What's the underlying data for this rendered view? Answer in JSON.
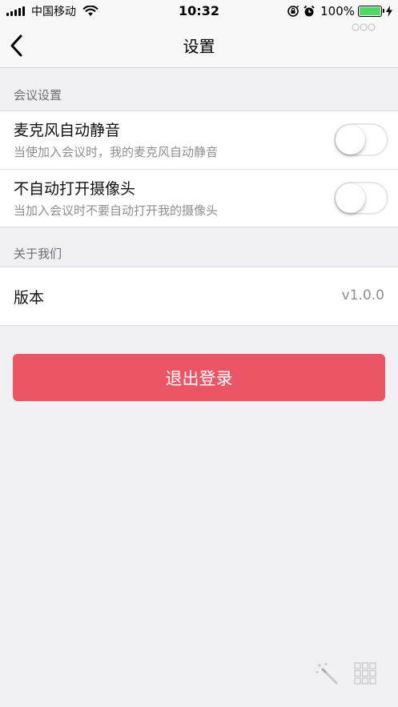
{
  "status_bar": {
    "carrier": "中国移动",
    "time": "10:32",
    "battery_percent": "100%",
    "icons": [
      "signal-icon",
      "wifi-icon",
      "orientation-lock-icon",
      "alarm-icon",
      "battery-icon",
      "charging-icon"
    ]
  },
  "nav": {
    "title": "设置",
    "back_icon": "chevron-left-icon",
    "more_icon": "more-dots-icon"
  },
  "sections": {
    "meeting": {
      "header": "会议设置",
      "items": [
        {
          "title": "麦克风自动静音",
          "subtitle": "当使加入会议时，我的麦克风自动静音",
          "toggle_on": false
        },
        {
          "title": "不自动打开摄像头",
          "subtitle": "当加入会议时不要自动打开我的摄像头",
          "toggle_on": false
        }
      ]
    },
    "about": {
      "header": "关于我们",
      "items": [
        {
          "title": "版本",
          "value": "v1.0.0"
        }
      ]
    }
  },
  "logout_label": "退出登录",
  "floating_tools": [
    "magic-wand-icon",
    "grid-icon"
  ],
  "colors": {
    "background": "#efeff4",
    "logout_button": "#ec5564",
    "battery_fill": "#4cd964",
    "secondary_text": "#8e8e93"
  }
}
